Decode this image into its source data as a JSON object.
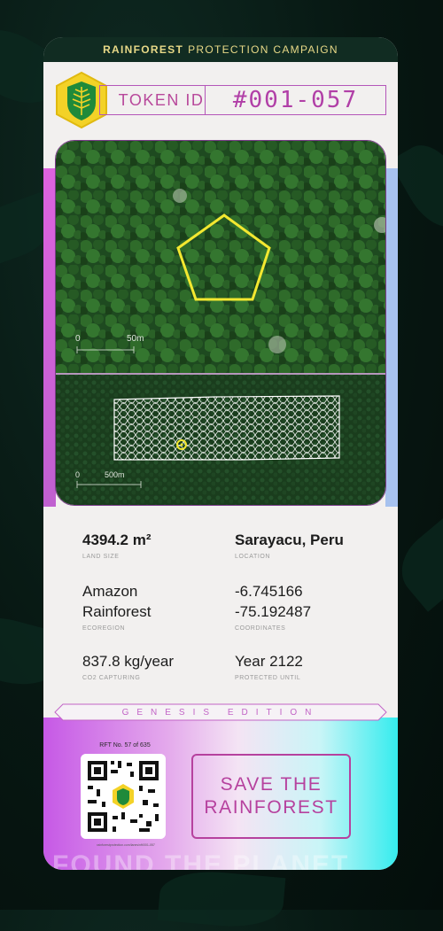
{
  "header": {
    "title_strong": "RAINFOREST",
    "title_rest": "PROTECTION CAMPAIGN"
  },
  "token": {
    "label": "TOKEN ID",
    "value": "#001-057"
  },
  "map": {
    "top_scale": [
      "0",
      "50m"
    ],
    "bottom_scale": [
      "0",
      "500m"
    ]
  },
  "stats": {
    "land_size": {
      "value": "4394.2 m²",
      "label": "LAND SIZE"
    },
    "location": {
      "value": "Sarayacu, Peru",
      "label": "LOCATION"
    },
    "ecoregion": {
      "value_line1": "Amazon",
      "value_line2": "Rainforest",
      "label": "ECOREGION"
    },
    "coordinates": {
      "value_line1": "-6.745166",
      "value_line2": "-75.192487",
      "label": "COORDINATES"
    },
    "co2": {
      "value": "837.8 kg/year",
      "label": "CO2 CAPTURING"
    },
    "protected": {
      "value": "Year 2122",
      "label": "PROTECTED UNTIL"
    }
  },
  "edition": "GENESIS EDITION",
  "bottom": {
    "rft": "RFT No. 57 of 635",
    "url": "rainforestprotection.com/lanes/nft/001-057",
    "cta_line1": "SAVE THE",
    "cta_line2": "RAINFOREST",
    "watermark": "FOUND THE PLANET"
  },
  "colors": {
    "accent_pink": "#b6419e",
    "header_gold": "#e8d987",
    "highlight_yellow": "#f3e830"
  },
  "icons": [
    "pine-leaf-icon",
    "qr-code-icon"
  ]
}
